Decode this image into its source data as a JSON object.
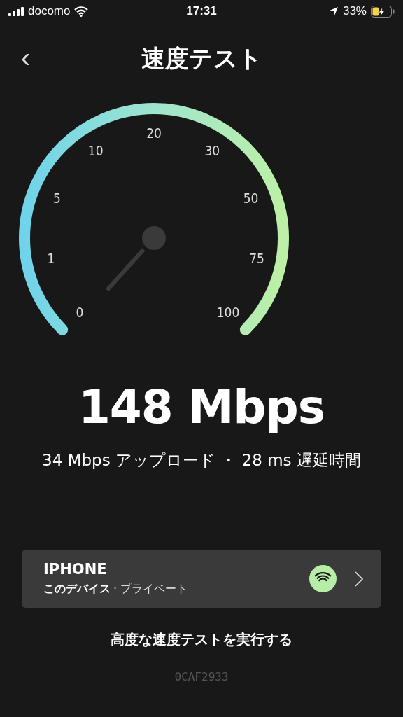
{
  "status_bar": {
    "carrier": "docomo",
    "time": "17:31",
    "battery": "33%",
    "charging": true
  },
  "header": {
    "back": "‹",
    "title": "速度テスト"
  },
  "gauge": {
    "labels": [
      "0",
      "1",
      "5",
      "10",
      "20",
      "30",
      "50",
      "75",
      "100"
    ]
  },
  "result": {
    "download": "148 Mbps",
    "details": "34 Mbps アップロード ・ 28 ms 遅延時間"
  },
  "device": {
    "name": "IPHONE",
    "owner": "このデバイス",
    "network": "· プライベート"
  },
  "advanced_link": "高度な速度テストを実行する",
  "code": "0CAF2933"
}
